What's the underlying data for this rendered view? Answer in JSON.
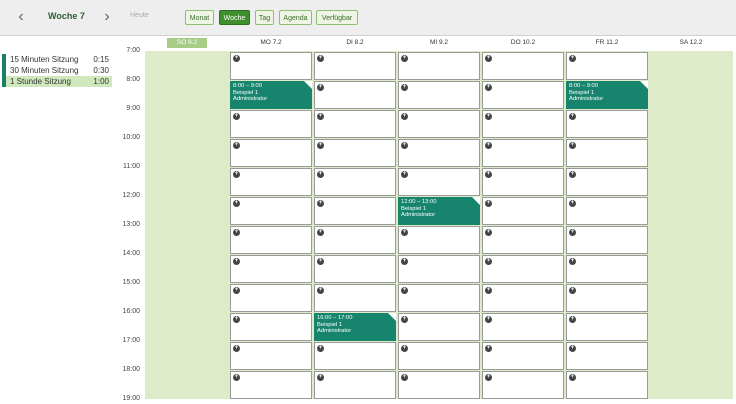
{
  "toolbar": {
    "prev_icon": "‹",
    "next_icon": "›",
    "week_title": "Woche 7",
    "today_label": "Heute",
    "views": [
      {
        "label": "Monat",
        "active": false
      },
      {
        "label": "Woche",
        "active": true
      },
      {
        "label": "Tag",
        "active": false
      },
      {
        "label": "Agenda",
        "active": false
      },
      {
        "label": "Verfügbar",
        "active": false
      }
    ]
  },
  "event_types": [
    {
      "label": "15 Minuten Sitzung",
      "duration": "0:15",
      "selected": false
    },
    {
      "label": "30 Minuten Sitzung",
      "duration": "0:30",
      "selected": false
    },
    {
      "label": "1 Stunde Sitzung",
      "duration": "1:00",
      "selected": true
    }
  ],
  "days": [
    {
      "label": "SO 6.2",
      "today": true
    },
    {
      "label": "MO 7.2",
      "today": false
    },
    {
      "label": "DI 8.2",
      "today": false
    },
    {
      "label": "MI 9.2",
      "today": false
    },
    {
      "label": "DO 10.2",
      "today": false
    },
    {
      "label": "FR 11.2",
      "today": false
    },
    {
      "label": "SA 12.2",
      "today": false
    }
  ],
  "times": [
    "7:00",
    "8:00",
    "9:00",
    "10:00",
    "11:00",
    "12:00",
    "13:00",
    "14:00",
    "15:00",
    "16:00",
    "17:00",
    "18:00",
    "19:00"
  ],
  "events": [
    {
      "day": 1,
      "hour": 1,
      "time": "8:00 – 9:00",
      "title": "Beispiel 1",
      "owner": "Administrator"
    },
    {
      "day": 5,
      "hour": 1,
      "time": "8:00 – 9:00",
      "title": "Beispiel 1",
      "owner": "Administrator"
    },
    {
      "day": 3,
      "hour": 5,
      "time": "12:00 – 13:00",
      "title": "Beispiel 1",
      "owner": "Administrator"
    },
    {
      "day": 2,
      "hour": 9,
      "time": "16:00 – 17:00",
      "title": "Beispiel 1",
      "owner": "Administrator"
    }
  ],
  "icons": {
    "add_slot": "+"
  },
  "colors": {
    "accent": "#3f8f2f",
    "event": "#17856e",
    "background_green": "#deebc9"
  }
}
